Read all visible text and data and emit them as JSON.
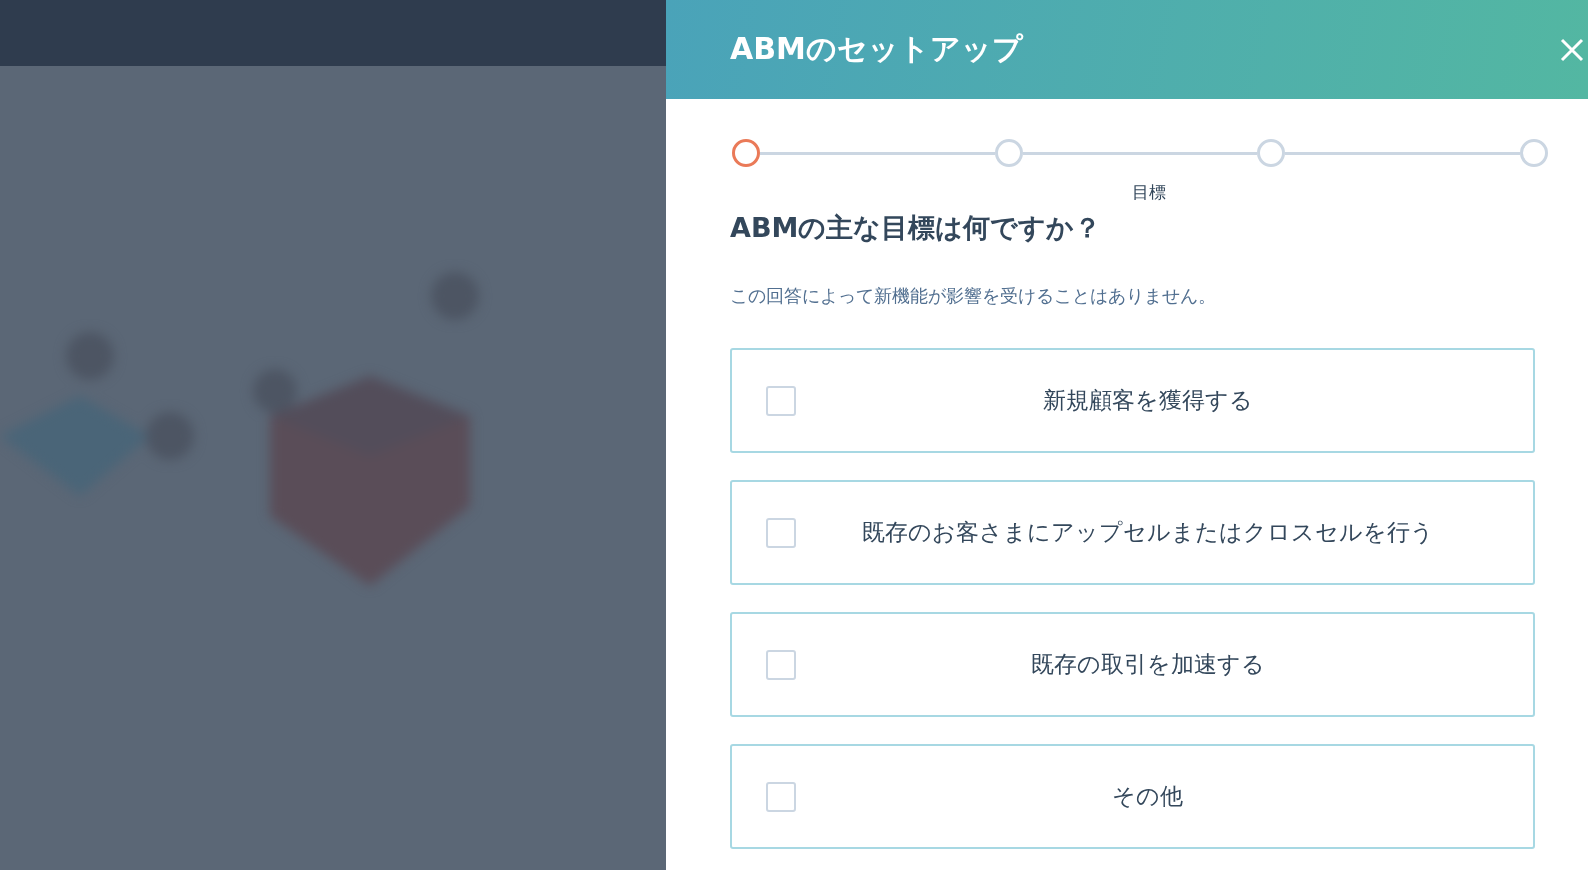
{
  "panel": {
    "title": "ABMのセットアップ"
  },
  "stepper": {
    "steps": [
      {
        "selected": true
      },
      {
        "selected": false
      },
      {
        "selected": false
      },
      {
        "selected": false
      }
    ],
    "label": "目標"
  },
  "question": {
    "heading": "ABMの主な目標は何ですか？",
    "note": "この回答によって新機能が影響を受けることはありません。"
  },
  "options": [
    {
      "label": "新規顧客を獲得する",
      "checked": false
    },
    {
      "label": "既存のお客さまにアップセルまたはクロスセルを行う",
      "checked": false
    },
    {
      "label": "既存の取引を加速する",
      "checked": false
    },
    {
      "label": "その他",
      "checked": false
    }
  ]
}
